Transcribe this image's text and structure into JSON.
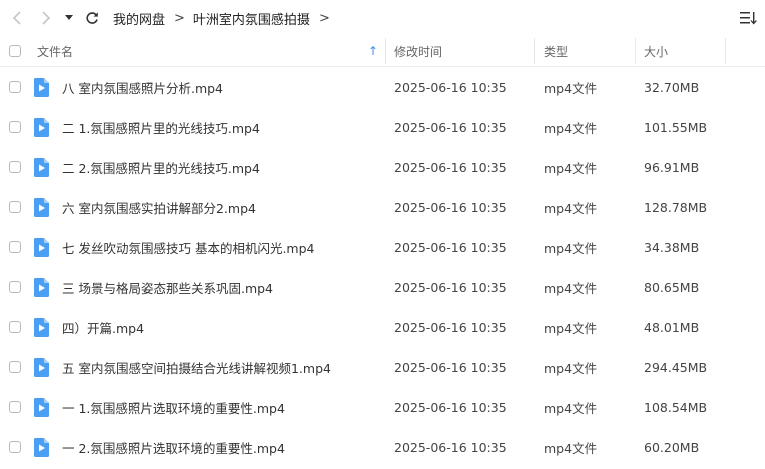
{
  "breadcrumb": {
    "items": [
      "我的网盘",
      "叶洲室内氛围感拍摄"
    ],
    "separator": ">"
  },
  "columns": {
    "name": "文件名",
    "modified": "修改时间",
    "type": "类型",
    "size": "大小",
    "sort_indicator": "↑"
  },
  "icons": {
    "back": "chevron-left-icon",
    "forward": "chevron-right-icon",
    "history": "caret-down-icon",
    "refresh": "refresh-icon",
    "view_menu": "list-sort-icon",
    "file": "video-file-icon"
  },
  "colors": {
    "file_icon": "#4a9ff5",
    "nav_disabled": "#c6c6c6"
  },
  "files": [
    {
      "name": "八 室内氛围感照片分析.mp4",
      "modified": "2025-06-16 10:35",
      "type": "mp4文件",
      "size": "32.70MB"
    },
    {
      "name": "二 1.氛围感照片里的光线技巧.mp4",
      "modified": "2025-06-16 10:35",
      "type": "mp4文件",
      "size": "101.55MB"
    },
    {
      "name": "二 2.氛围感照片里的光线技巧.mp4",
      "modified": "2025-06-16 10:35",
      "type": "mp4文件",
      "size": "96.91MB"
    },
    {
      "name": "六 室内氛围感实拍讲解部分2.mp4",
      "modified": "2025-06-16 10:35",
      "type": "mp4文件",
      "size": "128.78MB"
    },
    {
      "name": "七 发丝吹动氛围感技巧 基本的相机闪光.mp4",
      "modified": "2025-06-16 10:35",
      "type": "mp4文件",
      "size": "34.38MB"
    },
    {
      "name": "三 场景与格局姿态那些关系巩固.mp4",
      "modified": "2025-06-16 10:35",
      "type": "mp4文件",
      "size": "80.65MB"
    },
    {
      "name": "四）开篇.mp4",
      "modified": "2025-06-16 10:35",
      "type": "mp4文件",
      "size": "48.01MB"
    },
    {
      "name": "五 室内氛围感空间拍摄结合光线讲解视频1.mp4",
      "modified": "2025-06-16 10:35",
      "type": "mp4文件",
      "size": "294.45MB"
    },
    {
      "name": "一 1.氛围感照片选取环境的重要性.mp4",
      "modified": "2025-06-16 10:35",
      "type": "mp4文件",
      "size": "108.54MB"
    },
    {
      "name": "一 2.氛围感照片选取环境的重要性.mp4",
      "modified": "2025-06-16 10:35",
      "type": "mp4文件",
      "size": "60.20MB"
    }
  ]
}
